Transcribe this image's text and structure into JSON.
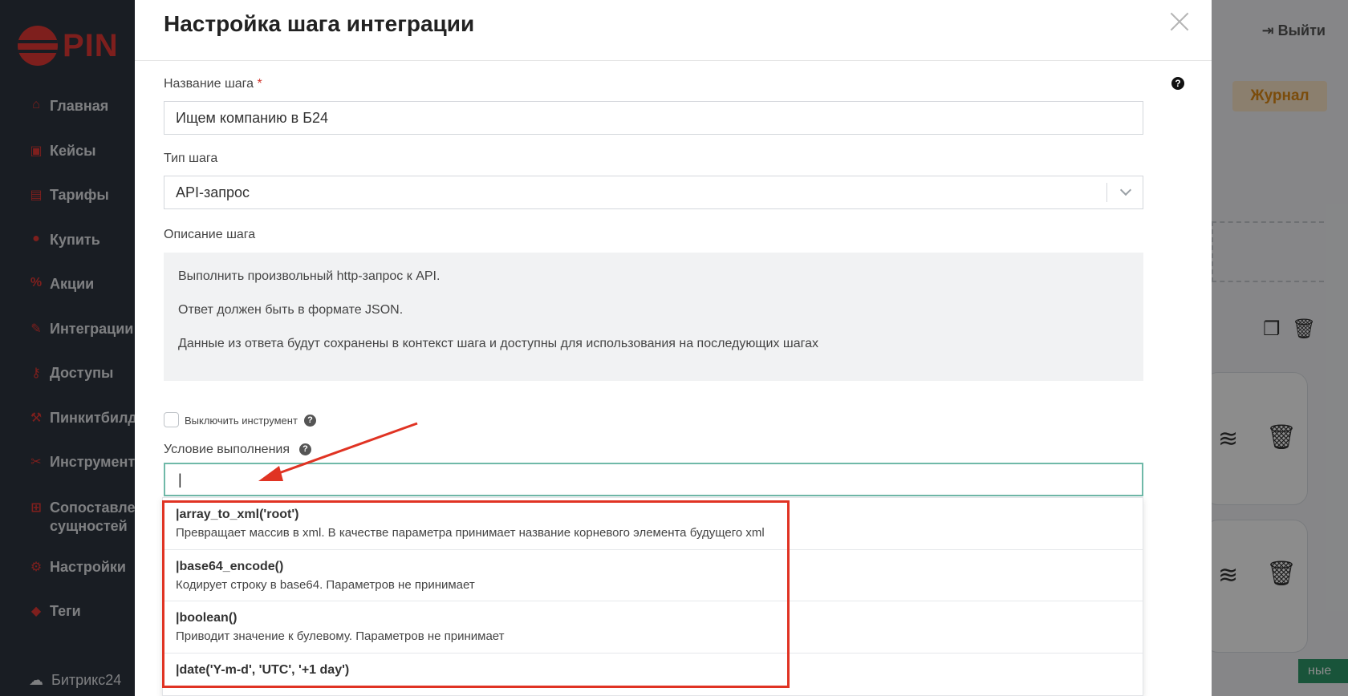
{
  "app": {
    "logo_text": "PIN",
    "logout": "Выйти",
    "journal": "Журнал",
    "bitrix": "Битрикс24",
    "green_btn": "ные"
  },
  "sidebar": {
    "items": [
      {
        "icon": "home-icon",
        "glyph": "⌂",
        "label": "Главная"
      },
      {
        "icon": "briefcase-icon",
        "glyph": "▣",
        "label": "Кейсы"
      },
      {
        "icon": "tariff-icon",
        "glyph": "▤",
        "label": "Тарифы"
      },
      {
        "icon": "ruble-icon",
        "glyph": "●",
        "label": "Купить"
      },
      {
        "icon": "percent-icon",
        "glyph": "%",
        "label": "Акции"
      },
      {
        "icon": "plug-icon",
        "glyph": "✎",
        "label": "Интеграции"
      },
      {
        "icon": "key-icon",
        "glyph": "⚷",
        "label": "Доступы"
      },
      {
        "icon": "hammer-icon",
        "glyph": "⚒",
        "label": "Пинкитбилд"
      },
      {
        "icon": "wrench-icon",
        "glyph": "✂",
        "label": "Инструмент"
      },
      {
        "icon": "grid-icon",
        "glyph": "⊞",
        "label": "Сопоставление сущностей"
      },
      {
        "icon": "gear-icon",
        "glyph": "⚙",
        "label": "Настройки"
      },
      {
        "icon": "tag-icon",
        "glyph": "◆",
        "label": "Теги"
      }
    ]
  },
  "modal": {
    "title": "Настройка шага интеграции",
    "step_name_label": "Название шага",
    "required_mark": "*",
    "step_name_value": "Ищем компанию в Б24",
    "step_type_label": "Тип шага",
    "step_type_value": "API-запрос",
    "description_label": "Описание шага",
    "description": [
      "Выполнить произвольный http-запрос к API.",
      "Ответ должен быть в формате JSON.",
      "Данные из ответа будут сохранены в контекст шага и доступны для использования на последующих шагах"
    ],
    "disable_tool_label": "Выключить инструмент",
    "condition_label": "Условие выполнения",
    "condition_value": "|"
  },
  "autocomplete": [
    {
      "title": "|array_to_xml('root')",
      "desc": "Превращает массив в xml. В качестве параметра принимает название корневого элемента будущего xml"
    },
    {
      "title": "|base64_encode()",
      "desc": "Кодирует строку в base64. Параметров не принимает"
    },
    {
      "title": "|boolean()",
      "desc": "Приводит значение к булевому. Параметров не принимает"
    },
    {
      "title": "|date('Y-m-d', 'UTC', '+1 day')",
      "desc": ""
    }
  ],
  "colors": {
    "accent_red": "#e03323",
    "focus_border": "#6fb9a8",
    "sidebar_bg": "#2e3541"
  }
}
